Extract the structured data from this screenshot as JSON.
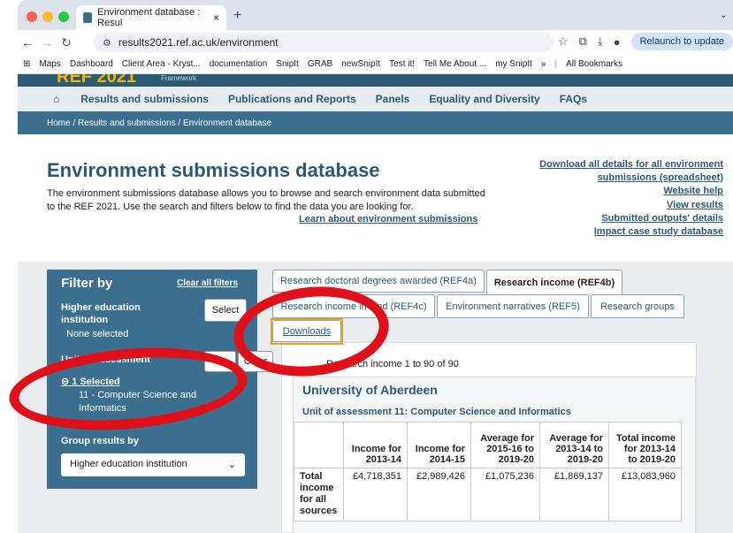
{
  "browser": {
    "tab_title": "Environment database : Resul",
    "tab_close": "×",
    "new_tab": "+",
    "url": "results2021.ref.ac.uk/environment",
    "relaunch": "Relaunch to update",
    "bookmarks": [
      "Maps",
      "Dashboard",
      "Client Area - Kryst...",
      "documentation",
      "SnipIt",
      "GRAB",
      "newSnipIt",
      "Test it!",
      "Tell Me About ...",
      "my SnipIt"
    ],
    "more": "»",
    "all_bookmarks": "All Bookmarks"
  },
  "site": {
    "logo": "REF 2021",
    "framework": "Framework",
    "nav": [
      "Results and submissions",
      "Publications and Reports",
      "Panels",
      "Equality and Diversity",
      "FAQs"
    ],
    "breadcrumb": "Home / Results and submissions / Environment database"
  },
  "hero": {
    "title": "Environment submissions database",
    "description": "The environment submissions database allows you to browse and search environment data submitted to the REF 2021. Use the search and filters below to find the data you are looking for.",
    "learn": "Learn about environment submissions",
    "links": [
      "Download all details for all environment",
      "submissions (spreadsheet)",
      "Website help",
      "View results",
      "Submitted outputs' details",
      "Impact case study database"
    ]
  },
  "filter": {
    "heading": "Filter by",
    "clear_all": "Clear all filters",
    "hei_label": "Higher education institution",
    "hei_value": "None selected",
    "select_btn": "Select",
    "uoa_label": "Unit of assessment",
    "clear_btn": "Clear",
    "selected": "1 Selected",
    "uoa_value": "11 - Computer Science and Informatics",
    "group_label": "Group results by",
    "group_value": "Higher education institution",
    "chevron": "⌄"
  },
  "tabs": [
    "Research doctoral degrees awarded (REF4a)",
    "Research income (REF4b)",
    "Research income in-kind (REF4c)",
    "Environment narratives (REF5)",
    "Research groups",
    "Downloads"
  ],
  "results": {
    "count": "Research income 1 to 90 of 90",
    "university": "University of Aberdeen",
    "unit": "Unit of assessment 11: Computer Science and Informatics",
    "headers": [
      "",
      "Income for 2013-14",
      "Income for 2014-15",
      "Average for 2015-16 to 2019-20",
      "Average for 2013-14 to 2019-20",
      "Total income for 2013-14 to 2019-20"
    ],
    "row_label": "Total income for all sources",
    "row_values": [
      "£4,718,351",
      "£2,989,426",
      "£1,075,236",
      "£1,869,137",
      "£13,083,960"
    ]
  }
}
